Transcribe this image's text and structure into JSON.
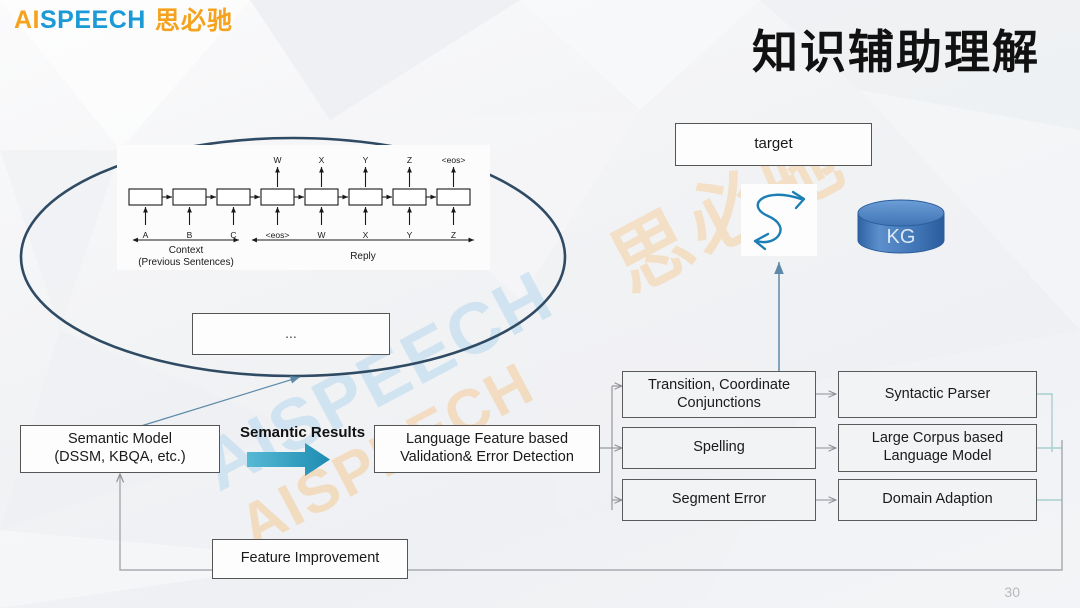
{
  "logo": {
    "mark_a": "AI",
    "mark_b": "SPEECH",
    "cn": "思必驰"
  },
  "title": "知识辅助理解",
  "watermarks": {
    "cn": "思必驰",
    "en": "AISPEECH",
    "en2": "AISPEECH"
  },
  "page_number": "30",
  "rnn": {
    "outputs": [
      "W",
      "X",
      "Y",
      "Z",
      "<eos>"
    ],
    "inputs": [
      "A",
      "B",
      "C",
      "<eos>",
      "W",
      "X",
      "Y",
      "Z"
    ],
    "span_left_line1": "Context",
    "span_left_line2": "(Previous Sentences)",
    "span_right": "Reply",
    "cell_count": 8
  },
  "ellipsis_box": {
    "label": "..."
  },
  "top": {
    "target_label": "target",
    "kg_label": "KG",
    "s_icon_name": "bidirectional-arrow-icon"
  },
  "flow": {
    "semantic_model_line1": "Semantic Model",
    "semantic_model_line2": "(DSSM, KBQA, etc.)",
    "semantic_results_label": "Semantic Results",
    "validation_line1": "Language Feature based",
    "validation_line2": "Validation& Error Detection",
    "feature_improvement": "Feature Improvement"
  },
  "middle_column": [
    {
      "line1": "Transition, Coordinate",
      "line2": "Conjunctions"
    },
    {
      "line1": "Spelling",
      "line2": ""
    },
    {
      "line1": "Segment Error",
      "line2": ""
    }
  ],
  "right_column": [
    {
      "line1": "Syntactic Parser",
      "line2": ""
    },
    {
      "line1": "Large Corpus based",
      "line2": "Language Model"
    },
    {
      "line1": "Domain Adaption",
      "line2": ""
    }
  ],
  "colors": {
    "brand_orange": "#f5a31e",
    "brand_blue": "#1b9ad6",
    "ellipse_stroke": "#2f4a63",
    "teal_arrow": "#2b9cc0",
    "kg_blue": "#3f74b5",
    "connector_gray": "#8d8f95",
    "connector_teal": "#a9d0cf"
  }
}
